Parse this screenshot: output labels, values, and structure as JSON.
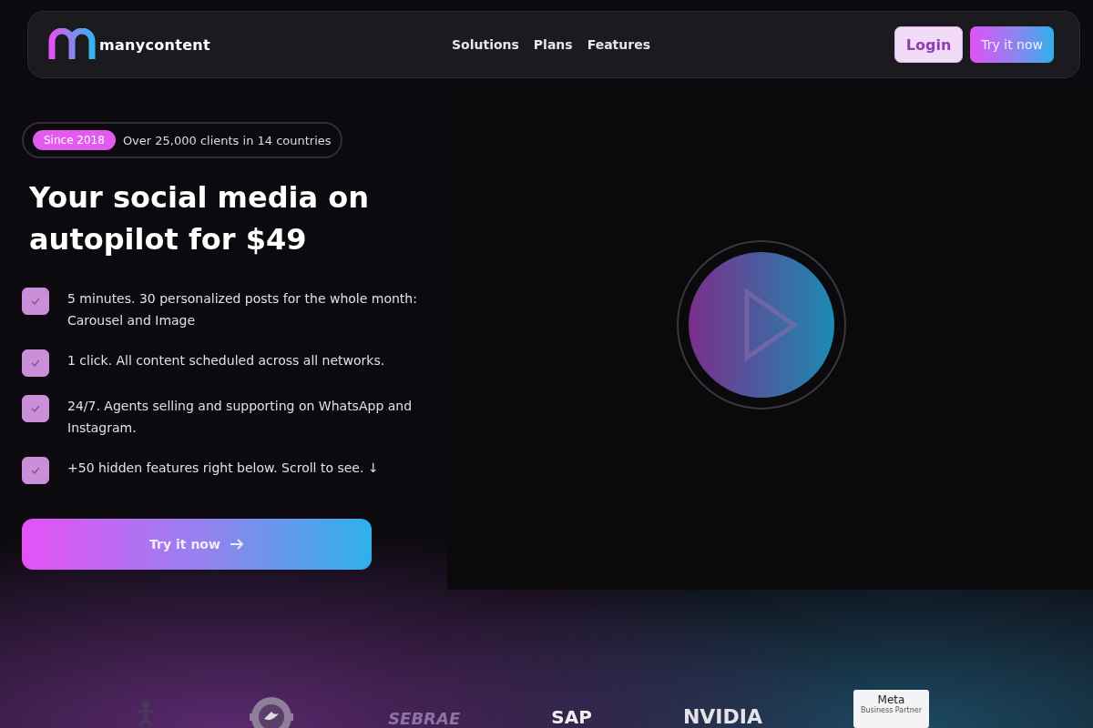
{
  "nav": {
    "logo": "manycontent",
    "links": [
      "Solutions",
      "Plans",
      "Features"
    ],
    "login": "Login",
    "cta": "Try it now"
  },
  "hero": {
    "badge": "Since 2018",
    "badge_text": "Over 25,000 clients in 14 countries",
    "title": "Your social media on autopilot for $49",
    "features": [
      {
        "text": "5 minutes. 30 personalized posts for the whole month: Carousel and Image",
        "checked": true
      },
      {
        "text": "1 click. All content scheduled across all networks.",
        "checked": true
      },
      {
        "text": "24/7. Agents selling and supporting on WhatsApp and Instagram.",
        "checked": true
      },
      {
        "text": "+50 hidden features right below. Scroll to see. ↓",
        "checked": true
      }
    ],
    "cta": "Try it now"
  },
  "partners": [
    {
      "kind": "figure"
    },
    {
      "kind": "badge"
    },
    {
      "kind": "text",
      "name": "SEBRAE"
    },
    {
      "kind": "text",
      "name": "SAP"
    },
    {
      "kind": "text",
      "name": "NVIDIA"
    },
    {
      "kind": "card",
      "name": "Meta",
      "sub": "Business Partner"
    }
  ]
}
